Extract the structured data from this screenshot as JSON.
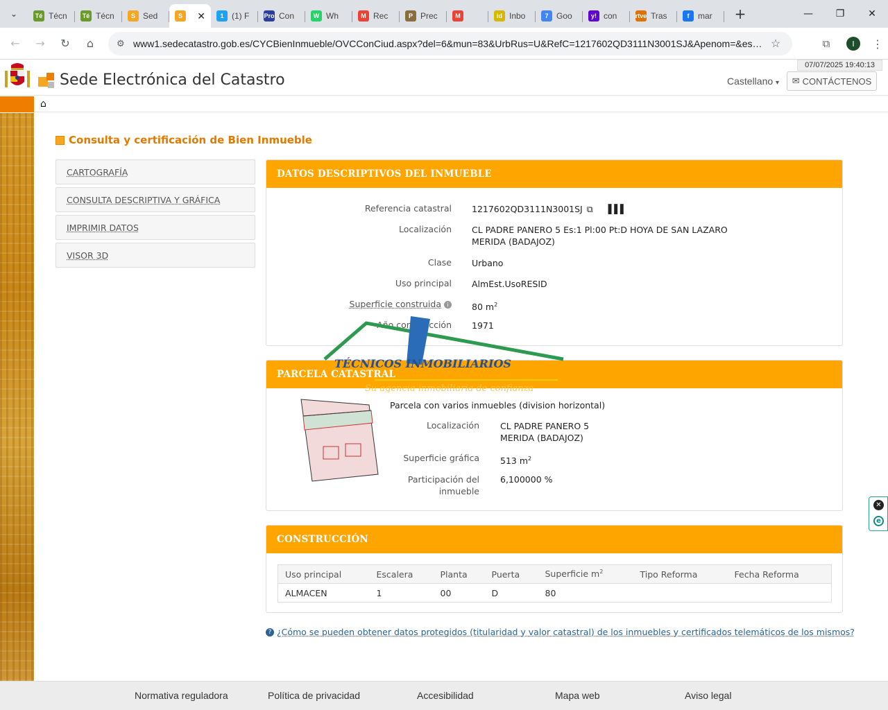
{
  "browser": {
    "tabs": [
      {
        "label": "Técn",
        "fav": "Té",
        "color": "#6a9a2a"
      },
      {
        "label": "Técn",
        "fav": "Té",
        "color": "#6a9a2a"
      },
      {
        "label": "Sed",
        "fav": "S",
        "color": "#f5a623"
      },
      {
        "label": "",
        "fav": "S",
        "color": "#f5a623"
      },
      {
        "label": "(1) F",
        "fav": "1",
        "color": "#1da1f2"
      },
      {
        "label": "Con",
        "fav": "Pro",
        "color": "#2b3d9e"
      },
      {
        "label": "Wh",
        "fav": "W",
        "color": "#25d366"
      },
      {
        "label": "Rec",
        "fav": "M",
        "color": "#ea4335"
      },
      {
        "label": "Prec",
        "fav": "P",
        "color": "#8a6d3b"
      },
      {
        "label": "",
        "fav": "M",
        "color": "#ea4335"
      },
      {
        "label": "Inbo",
        "fav": "id",
        "color": "#d6b800"
      },
      {
        "label": "Goo",
        "fav": "7",
        "color": "#4285f4"
      },
      {
        "label": "con",
        "fav": "y!",
        "color": "#6001d2"
      },
      {
        "label": "Tras",
        "fav": "rtve",
        "color": "#e07000"
      },
      {
        "label": "mar",
        "fav": "f",
        "color": "#1877f2"
      }
    ],
    "url": "www1.sedecatastro.gob.es/CYCBienInmueble/OVCConCiud.aspx?del=6&mun=83&UrbRus=U&RefC=1217602QD3111N3001SJ&Apenom=&esBi...",
    "avatar_letter": "I"
  },
  "header": {
    "datetime": "07/07/2025  19:40:13",
    "site_title": "Sede Electrónica del Catastro",
    "language": "Castellano",
    "contact_label": "CONTÁCTENOS"
  },
  "page": {
    "section_title": "Consulta y certificación de Bien Inmueble",
    "menu": [
      "CARTOGRAFÍA",
      "CONSULTA DESCRIPTIVA Y GRÁFICA",
      "IMPRIMIR DATOS",
      "VISOR 3D"
    ]
  },
  "datos": {
    "title": "DATOS DESCRIPTIVOS DEL INMUEBLE",
    "ref_label": "Referencia catastral",
    "ref_value": "1217602QD3111N3001SJ",
    "loc_label": "Localización",
    "loc_line1": "CL PADRE PANERO 5 Es:1 Pl:00 Pt:D HOYA DE SAN LAZARO",
    "loc_line2": "MERIDA (BADAJOZ)",
    "clase_label": "Clase",
    "clase_value": "Urbano",
    "uso_label": "Uso principal",
    "uso_value": "AlmEst.UsoRESID",
    "sup_label": "Superficie construida",
    "sup_value": "80 m",
    "anio_label": "Año construcción",
    "anio_value": "1971"
  },
  "parcela": {
    "title": "PARCELA CATASTRAL",
    "desc": "Parcela con varios inmuebles (division horizontal)",
    "loc_label": "Localización",
    "loc_line1": "CL PADRE PANERO 5",
    "loc_line2": "MERIDA (BADAJOZ)",
    "sup_label": "Superficie gráfica",
    "sup_value": "513 m",
    "part_label1": "Participación del",
    "part_label2": "inmueble",
    "part_value": "6,100000 %"
  },
  "construccion": {
    "title": "CONSTRUCCIÓN",
    "headers": [
      "Uso principal",
      "Escalera",
      "Planta",
      "Puerta",
      "Superficie m",
      "Tipo Reforma",
      "Fecha Reforma"
    ],
    "rows": [
      [
        "ALMACEN",
        "1",
        "00",
        "D",
        "80",
        "",
        ""
      ]
    ]
  },
  "help_link": "¿Cómo se pueden obtener datos protegidos (titularidad y valor catastral) de los inmuebles y certificados telemáticos de los mismos?",
  "watermark": {
    "text": "TÉCNICOS INMOBILIARIOS",
    "tagline": "Su agencia inmobiliaria de confianza"
  },
  "footer": [
    "Normativa reguladora",
    "Política de privacidad",
    "Accesibilidad",
    "Mapa web",
    "Aviso legal"
  ],
  "colors": {
    "accent_orange": "#fea500",
    "title_orange": "#e07b00",
    "link_blue": "#2a6496"
  }
}
